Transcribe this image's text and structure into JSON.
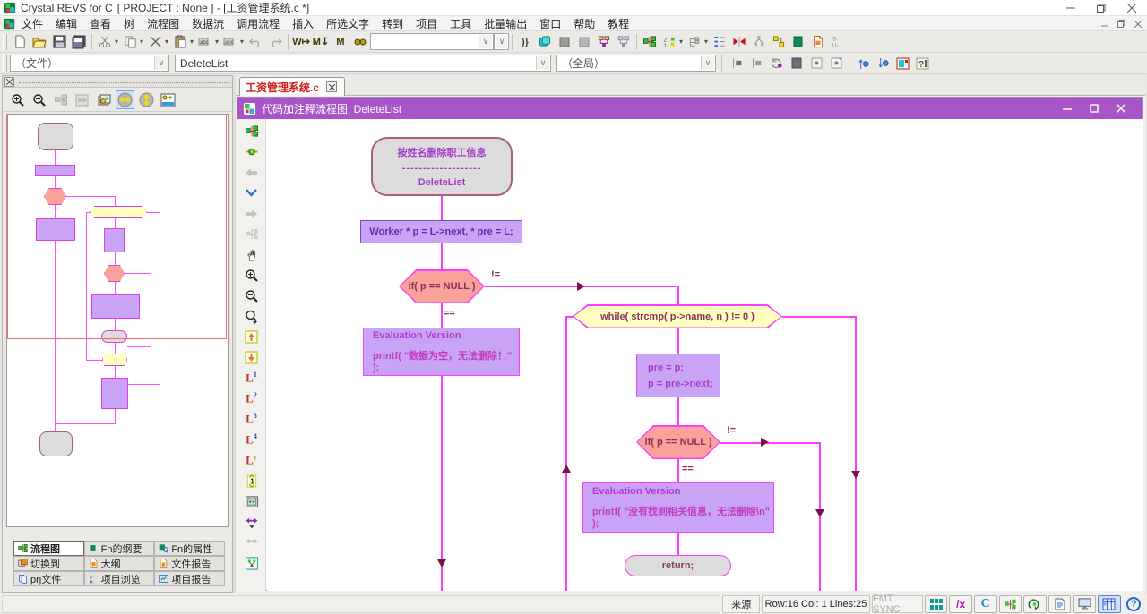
{
  "window": {
    "app_name": "Crystal REVS for C",
    "project_suffix": "[ PROJECT : None ] - [工资管理系统.c *]"
  },
  "menubar": {
    "items": [
      "文件",
      "编辑",
      "查看",
      "树",
      "流程图",
      "数据流",
      "调用流程",
      "插入",
      "所选文字",
      "转到",
      "项目",
      "工具",
      "批量输出",
      "窗口",
      "帮助",
      "教程"
    ]
  },
  "toolbar_nav": {
    "file_scope": "（文件）",
    "function_name": "DeleteList",
    "global_scope": "（全局）",
    "search_value": ""
  },
  "left_panel": {
    "tabs": [
      {
        "label": "流程图"
      },
      {
        "label": "Fn的纲要"
      },
      {
        "label": "Fn的属性"
      },
      {
        "label": "切换到"
      },
      {
        "label": "大纲"
      },
      {
        "label": "文件报告"
      },
      {
        "label": "prj文件"
      },
      {
        "label": "项目浏览"
      },
      {
        "label": "项目报告"
      }
    ]
  },
  "document": {
    "tab_label": "工资管理系统.c",
    "window_title": "代码加注释流程图:  DeleteList"
  },
  "flowchart": {
    "start_line1": "按姓名删除职工信息",
    "start_divider": "-------------------",
    "start_line2": "DeleteList",
    "decl": "Worker * p = L->next, * pre = L;",
    "if1": "if( p == NULL )",
    "label_ne": "!=",
    "label_eq": "==",
    "eval1_title": "Evaluation Version",
    "eval1_code": "printf( \"数据为空，无法删除！\" );",
    "while1": "while( strcmp( p->name, n ) != 0 )",
    "body_line1": "pre = p;",
    "body_line2": "p = pre->next;",
    "if2": "if( p == NULL )",
    "eval2_title": "Evaluation Version",
    "eval2_code": "printf( \"没有找到相关信息，无法删除\\n\" );",
    "return_text": "return;"
  },
  "status": {
    "source": "来源",
    "row_col": "Row:16 Col:  1 Lines:25",
    "fmt_sync": "FMT SYNC"
  },
  "colors": {
    "doc_titlebar": "#a855c7",
    "flow_line": "#ff3dff",
    "arrow": "#7a1048",
    "node_purple": "#c9a3f5",
    "node_salmon": "#f8a29a",
    "node_yellow": "#ffffbe",
    "node_gray": "#dcdcdc",
    "tab_text_red": "#cc1f1f"
  }
}
